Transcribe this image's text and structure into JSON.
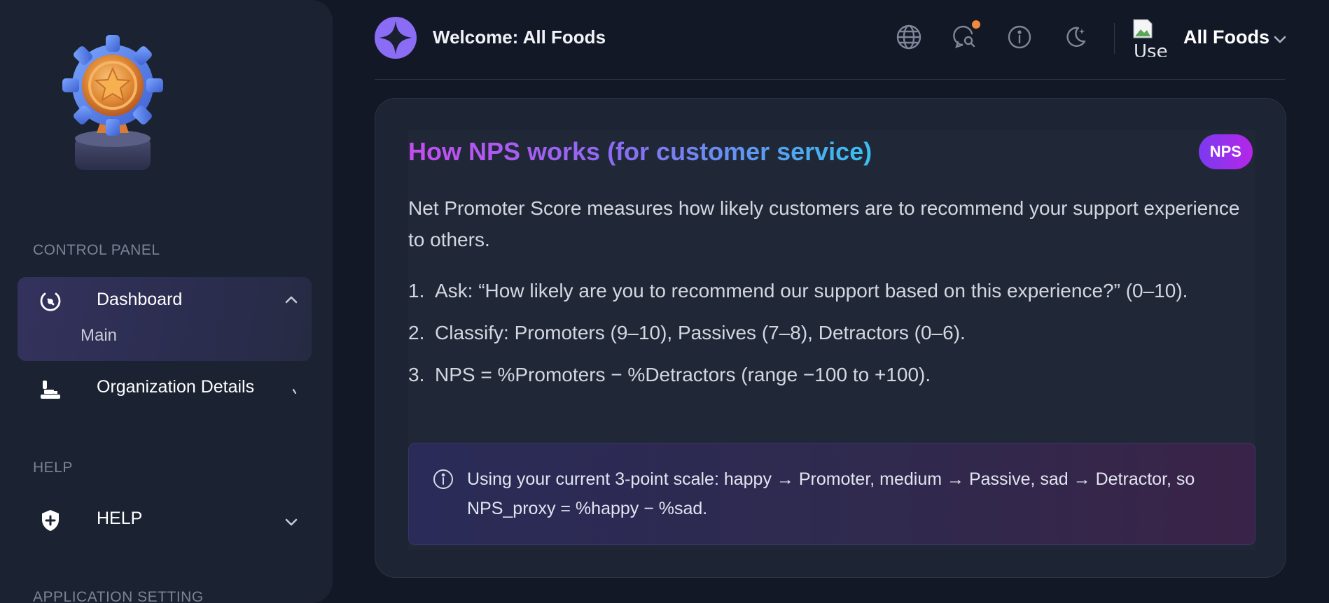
{
  "sidebar": {
    "sections": {
      "control_panel": "CONTROL PANEL",
      "help": "HELP",
      "application_setting": "APPLICATION SETTING"
    },
    "items": {
      "dashboard": {
        "label": "Dashboard",
        "sub": "Main",
        "icon": "gauge-icon",
        "chevron": "chevron-up-icon"
      },
      "organization": {
        "label": "Organization Details",
        "icon": "org-icon",
        "chevron": "chevron-right-icon"
      },
      "help": {
        "label": "HELP",
        "icon": "shield-plus-icon",
        "chevron": "chevron-down-icon"
      }
    }
  },
  "header": {
    "welcome": "Welcome: All Foods",
    "icons": [
      "globe-icon",
      "search-chat-icon",
      "info-icon",
      "moon-icon"
    ],
    "avatar_alt": "Use",
    "org_name": "All Foods"
  },
  "card": {
    "title": "How NPS works (for customer service)",
    "badge": "NPS",
    "intro": "Net Promoter Score measures how likely customers are to recommend your support experience to others.",
    "steps": [
      {
        "num": "1.",
        "text": "Ask: “How likely are you to recommend our support based on this experience?” (0–10)."
      },
      {
        "num": "2.",
        "text": "Classify: Promoters (9–10), Passives (7–8), Detractors (0–6)."
      },
      {
        "num": "3.",
        "text": "NPS = %Promoters − %Detractors (range −100 to +100)."
      }
    ],
    "note": "Using your current 3-point scale: happy → Promoter, medium → Passive, sad → Detractor, so NPS_proxy = %happy − %sad."
  },
  "colors": {
    "accent_purple": "#7b3af0",
    "badge_magenta": "#b526e8",
    "title_gradient_start": "#c74cf0",
    "title_gradient_end": "#38c0f0",
    "notification": "#f08a3e"
  }
}
